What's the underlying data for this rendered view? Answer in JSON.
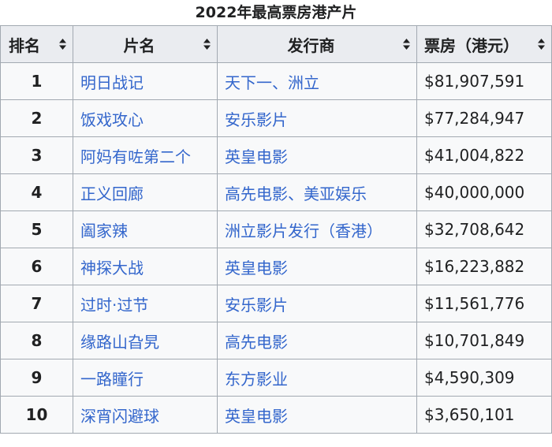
{
  "caption": "2022年最高票房港产片",
  "headers": {
    "rank": "排名",
    "title": "片名",
    "distributor": "发行商",
    "gross": "票房（港元）"
  },
  "rows": [
    {
      "rank": "1",
      "title": "明日战记",
      "distributor": "天下一、洲立",
      "gross": "$81,907,591"
    },
    {
      "rank": "2",
      "title": "饭戏攻心",
      "distributor": "安乐影片",
      "gross": "$77,284,947"
    },
    {
      "rank": "3",
      "title": "阿妈有咗第二个",
      "distributor": "英皇电影",
      "gross": "$41,004,822"
    },
    {
      "rank": "4",
      "title": "正义回廊",
      "distributor": "高先电影、美亚娱乐",
      "gross": "$40,000,000"
    },
    {
      "rank": "5",
      "title": "阖家辣",
      "distributor": "洲立影片发行（香港）",
      "gross": "$32,708,642"
    },
    {
      "rank": "6",
      "title": "神探大战",
      "distributor": "英皇电影",
      "gross": "$16,223,882"
    },
    {
      "rank": "7",
      "title": "过时·过节",
      "distributor": "安乐影片",
      "gross": "$11,561,776"
    },
    {
      "rank": "8",
      "title": "缘路山旮旯",
      "distributor": "高先电影",
      "gross": "$10,701,849"
    },
    {
      "rank": "9",
      "title": "一路瞳行",
      "distributor": "东方影业",
      "gross": "$4,590,309"
    },
    {
      "rank": "10",
      "title": "深宵闪避球",
      "distributor": "英皇电影",
      "gross": "$3,650,101"
    }
  ],
  "icons": {
    "sort": "sort-icon"
  },
  "colors": {
    "link": "#3366cc",
    "header_bg": "#eaecf0",
    "row_bg": "#f8f9fa",
    "border": "#a2a9b1"
  }
}
